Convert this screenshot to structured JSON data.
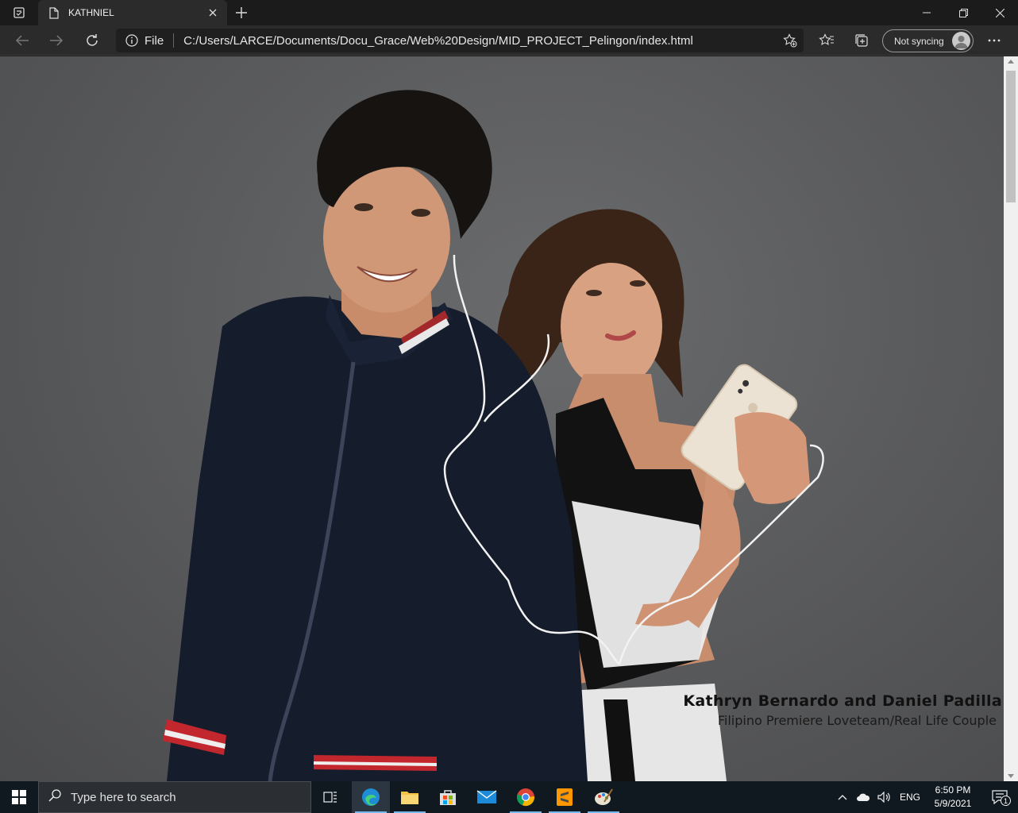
{
  "browser": {
    "tab_title": "KATHNIEL",
    "address_scheme": "File",
    "address_url": "C:/Users/LARCE/Documents/Docu_Grace/Web%20Design/MID_PROJECT_Pelingon/index.html",
    "sync_label": "Not syncing"
  },
  "page": {
    "caption_name": "Kathryn Bernardo and Daniel Padilla",
    "caption_sub": "Filipino Premiere Loveteam/Real Life Couple"
  },
  "taskbar": {
    "search_placeholder": "Type here to search",
    "apps": [
      "task-view",
      "edge",
      "file-explorer",
      "store",
      "mail",
      "chrome",
      "sublime-text",
      "paint"
    ],
    "language": "ENG",
    "time": "6:50 PM",
    "date": "5/9/2021",
    "notification_count": "1"
  },
  "colors": {
    "titlebar": "#1b1b1b",
    "toolbar": "#2b2b2b",
    "page_background": "#5b5c5e",
    "taskbar": "#101820"
  }
}
